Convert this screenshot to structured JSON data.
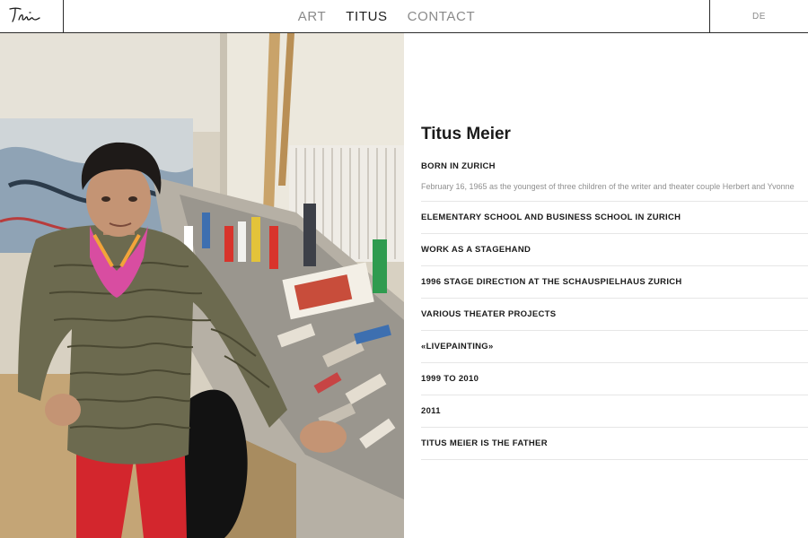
{
  "header": {
    "nav": [
      {
        "label": "ART",
        "active": false
      },
      {
        "label": "TITUS",
        "active": true
      },
      {
        "label": "CONTACT",
        "active": false
      }
    ],
    "language": "DE"
  },
  "photo": {
    "icon": "artist-studio-photo"
  },
  "bio": {
    "title": "Titus Meier",
    "items": [
      {
        "heading": "BORN IN ZURICH",
        "text": "February 16, 1965 as the youngest of three children of the writer and theater couple Herbert and Yvonne"
      },
      {
        "heading": "ELEMENTARY SCHOOL AND BUSINESS SCHOOL IN ZURICH"
      },
      {
        "heading": "WORK AS A STAGEHAND"
      },
      {
        "heading": "1996 STAGE DIRECTION AT THE SCHAUSPIELHAUS ZURICH"
      },
      {
        "heading": "VARIOUS THEATER PROJECTS"
      },
      {
        "heading": "«LIVEPAINTING»"
      },
      {
        "heading": "1999 TO 2010"
      },
      {
        "heading": "2011"
      },
      {
        "heading": "TITUS MEIER IS THE FATHER"
      }
    ]
  },
  "colors": {
    "accent": "#1b1b1b",
    "muted": "#8a8a8a",
    "divider": "#e6e6e6"
  }
}
